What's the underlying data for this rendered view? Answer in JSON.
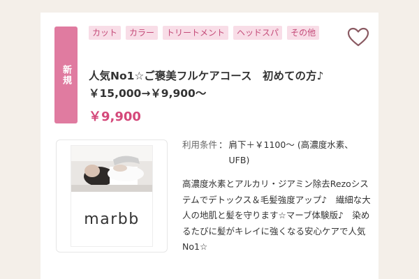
{
  "listing": {
    "new_badge": "新規",
    "tags": [
      "カット",
      "カラー",
      "トリートメント",
      "ヘッドスパ",
      "その他"
    ],
    "title": "人気No1☆ご褒美フルケアコース　初めての方♪　￥15,000→￥9,900～",
    "price": "￥9,900",
    "conditions_label": "利用条件",
    "conditions_separator": "：",
    "conditions_value": "肩下＋￥1100～ (高濃度水素、UFB)",
    "description": "高濃度水素とアルカリ・ジアミン除去Rezoシステムでデトックス＆毛髪強度アップ♪　繊細な大人の地肌と髪を守ります☆マーブ体験版♪　染めるたびに髪がキレイに強くなる安心ケアで人気No1☆",
    "thumbnail_logo_text": "marbb",
    "favorite_icon": "heart-outline-icon"
  },
  "colors": {
    "accent": "#e07ba0",
    "price": "#d4487a",
    "tag_bg": "#f8dde7",
    "tag_text": "#c44a78",
    "heart": "#8a5a62"
  }
}
